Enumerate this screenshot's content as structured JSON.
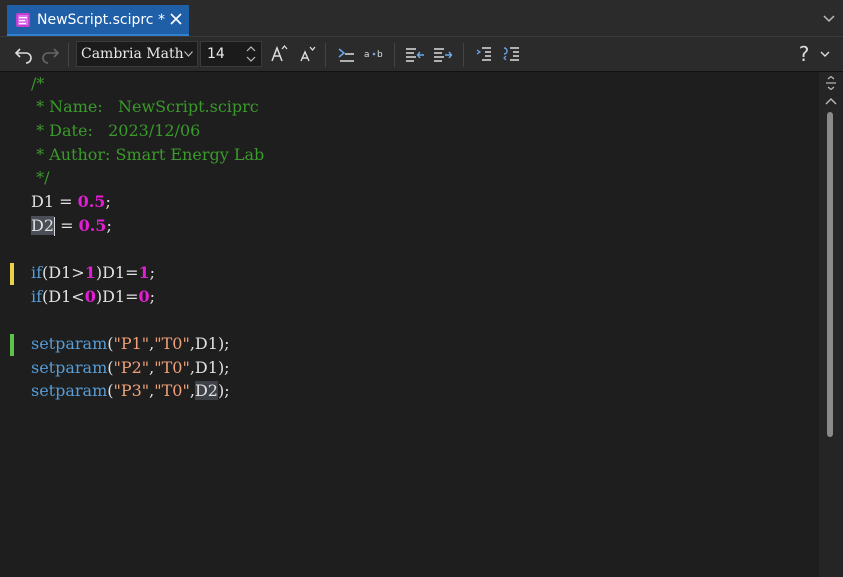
{
  "tab": {
    "title": "NewScript.sciprc *",
    "file_icon": "script-file-icon",
    "close_icon": "close-icon"
  },
  "tabbar": {
    "overflow_icon": "chevron-down-icon"
  },
  "toolbar": {
    "undo_icon": "undo-icon",
    "redo_icon": "redo-icon",
    "font_family": "Cambria Math",
    "font_size": "14",
    "grow_font_icon": "increase-font-icon",
    "shrink_font_icon": "decrease-font-icon",
    "help_label": "?",
    "accent_color": "#1f5fa8"
  },
  "code": {
    "lines": [
      "/*",
      " * Name:   NewScript.sciprc",
      " * Date:   2023/12/06",
      " * Author: Smart Energy Lab",
      " */",
      "D1 = 0.5;",
      "D2 = 0.5;",
      "",
      "if(D1>1)D1=1;",
      "if(D1<0)D1=0;",
      "",
      "setparam(\"P1\",\"T0\",D1);",
      "setparam(\"P2\",\"T0\",D1);",
      "setparam(\"P3\",\"T0\",D2);"
    ],
    "colors": {
      "comment": "#3a9a2a",
      "number": "#e21ed2",
      "keyword": "#569cd6",
      "string": "#f0a07a",
      "gutter_modified": "#e8d24a",
      "gutter_saved": "#5ec24a"
    }
  }
}
